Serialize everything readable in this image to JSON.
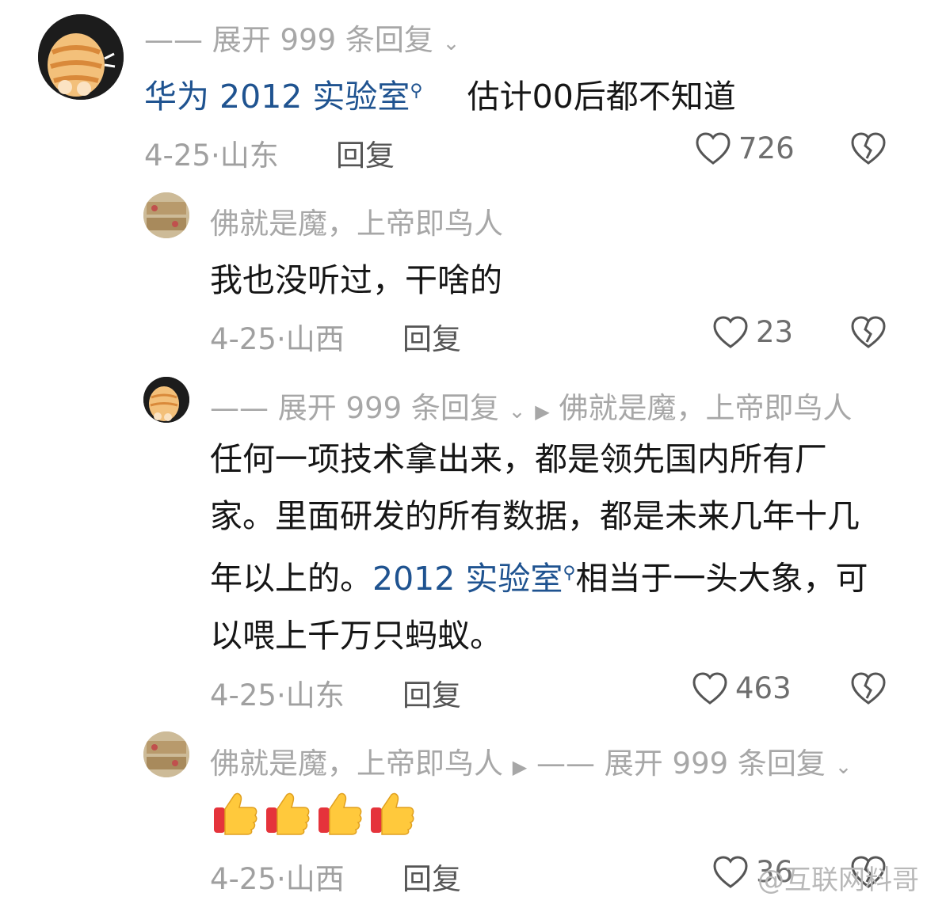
{
  "comments": [
    {
      "header": "—— 展开 999 条回复",
      "author_link": "华为 2012 实验室",
      "text": "估计00后都不知道",
      "date": "4-25·",
      "location": "山东",
      "reply_label": "回复",
      "likes": "726"
    },
    {
      "author": "佛就是魔，上帝即鸟人",
      "text": "我也没听过，干啥的",
      "date": "4-25·",
      "location": "山西",
      "reply_label": "回复",
      "likes": "23"
    },
    {
      "header": "—— 展开 999 条回复",
      "reply_to": "佛就是魔，上帝即鸟人",
      "text_part1": "任何一项技术拿出来，都是领先国内所有厂家。里面研发的所有数据，都是未来几年十几年以上的。",
      "text_link": "2012 实验室",
      "text_part2": "相当于一头大象，可以喂上千万只蚂蚁。",
      "date": "4-25·",
      "location": "山东",
      "reply_label": "回复",
      "likes": "463"
    },
    {
      "author": "佛就是魔，上帝即鸟人",
      "header": "—— 展开 999 条回复",
      "emoji_count": 4,
      "date": "4-25·",
      "location": "山西",
      "reply_label": "回复",
      "likes": "36"
    }
  ],
  "watermark": "@互联网料哥",
  "colors": {
    "link": "#1f5390",
    "meta": "#a0a0a0"
  },
  "icons": {
    "like": "heart-outline-icon",
    "dislike": "broken-heart-icon",
    "search": "magnifier-icon",
    "expand": "chevron-down-icon",
    "reply_arrow": "triangle-right-icon",
    "emoji": "thumbs-up-emoji"
  }
}
